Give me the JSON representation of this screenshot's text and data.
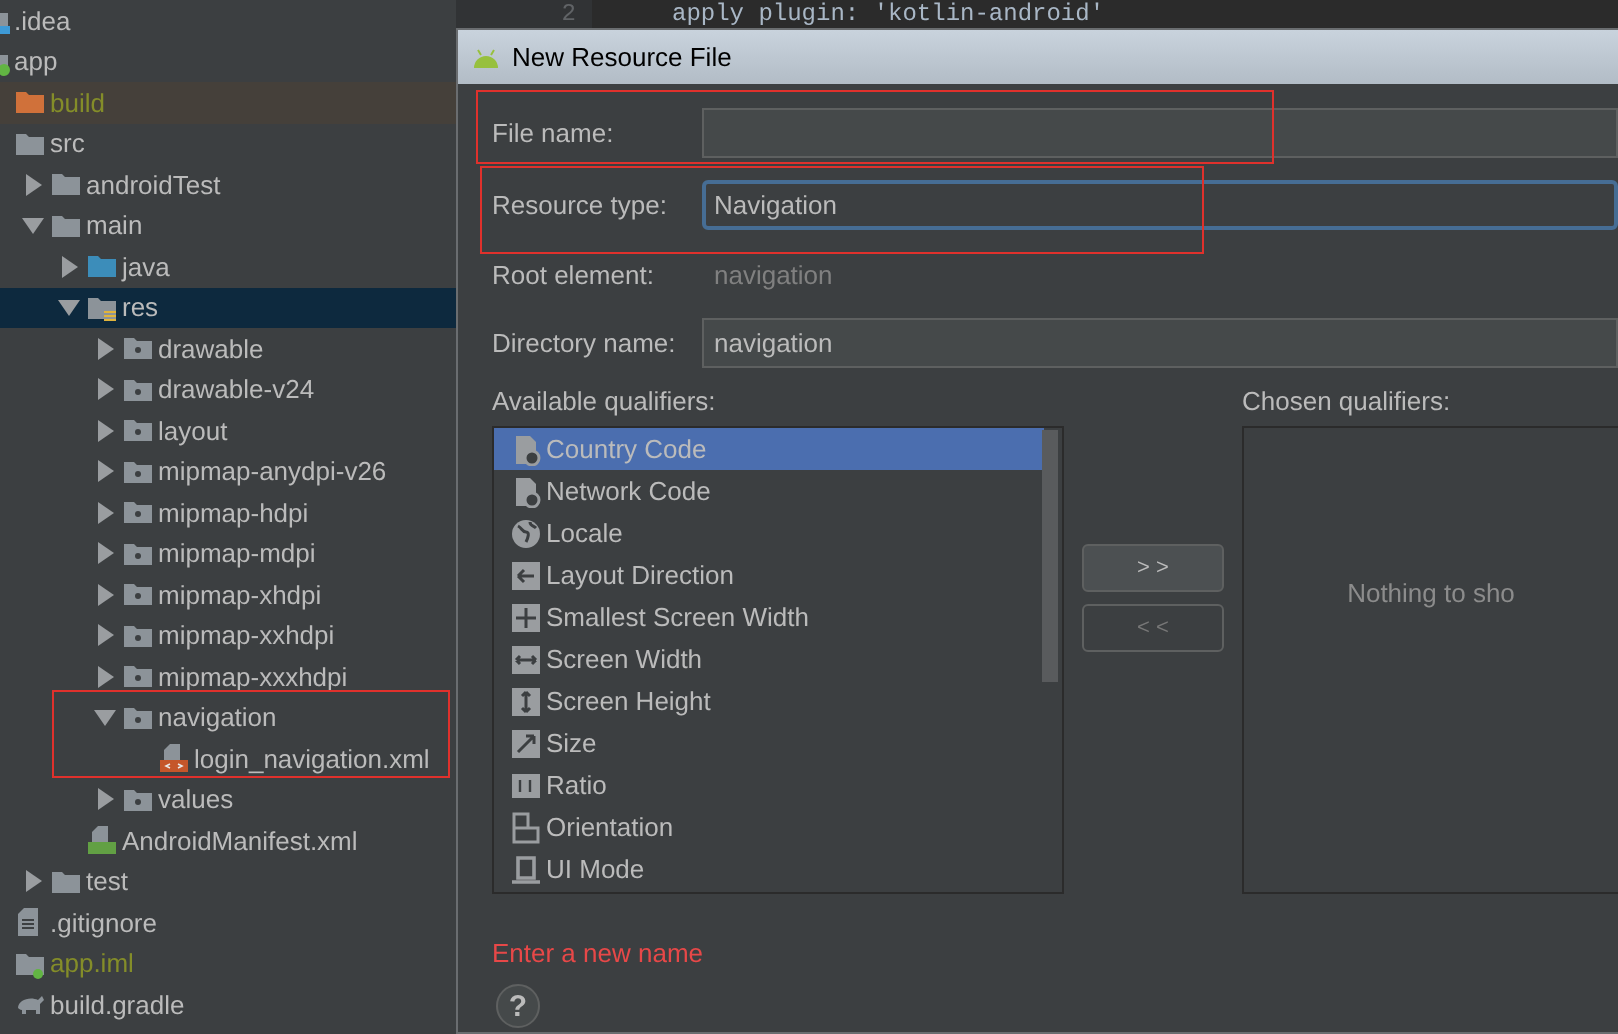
{
  "editor": {
    "line_number": "2",
    "code": "apply plugin: 'kotlin-android'"
  },
  "project_tree": [
    {
      "label": ".idea",
      "kind": "config-folder",
      "selected": false
    },
    {
      "label": "app",
      "kind": "module",
      "selected": false,
      "children": [
        {
          "label": "build",
          "kind": "excluded-folder",
          "excluded": true,
          "selected": false
        },
        {
          "label": "src",
          "kind": "folder",
          "selected": false,
          "children": [
            {
              "label": "androidTest",
              "kind": "folder",
              "expanded": false,
              "selected": false
            },
            {
              "label": "main",
              "kind": "folder",
              "expanded": true,
              "selected": false,
              "children": [
                {
                  "label": "java",
                  "kind": "source-folder",
                  "expanded": false,
                  "selected": false
                },
                {
                  "label": "res",
                  "kind": "res-folder",
                  "expanded": true,
                  "selected": true,
                  "children": [
                    {
                      "label": "drawable",
                      "kind": "res-dir",
                      "expanded": false,
                      "selected": false
                    },
                    {
                      "label": "drawable-v24",
                      "kind": "res-dir",
                      "expanded": false,
                      "selected": false
                    },
                    {
                      "label": "layout",
                      "kind": "res-dir",
                      "expanded": false,
                      "selected": false
                    },
                    {
                      "label": "mipmap-anydpi-v26",
                      "kind": "res-dir",
                      "expanded": false,
                      "selected": false
                    },
                    {
                      "label": "mipmap-hdpi",
                      "kind": "res-dir",
                      "expanded": false,
                      "selected": false
                    },
                    {
                      "label": "mipmap-mdpi",
                      "kind": "res-dir",
                      "expanded": false,
                      "selected": false
                    },
                    {
                      "label": "mipmap-xhdpi",
                      "kind": "res-dir",
                      "expanded": false,
                      "selected": false
                    },
                    {
                      "label": "mipmap-xxhdpi",
                      "kind": "res-dir",
                      "expanded": false,
                      "selected": false
                    },
                    {
                      "label": "mipmap-xxxhdpi",
                      "kind": "res-dir",
                      "expanded": false,
                      "selected": false
                    },
                    {
                      "label": "navigation",
                      "kind": "res-dir",
                      "expanded": true,
                      "selected": false,
                      "highlighted": true,
                      "children": [
                        {
                          "label": "login_navigation.xml",
                          "kind": "xml-file",
                          "selected": false
                        }
                      ]
                    },
                    {
                      "label": "values",
                      "kind": "res-dir",
                      "expanded": false,
                      "selected": false
                    }
                  ]
                },
                {
                  "label": "AndroidManifest.xml",
                  "kind": "manifest-file",
                  "selected": false
                }
              ]
            },
            {
              "label": "test",
              "kind": "folder",
              "expanded": false,
              "selected": false
            }
          ]
        },
        {
          "label": ".gitignore",
          "kind": "text-file",
          "selected": false
        },
        {
          "label": "app.iml",
          "kind": "iml-file",
          "excluded": true,
          "selected": false
        },
        {
          "label": "build.gradle",
          "kind": "gradle-file",
          "selected": false
        }
      ]
    }
  ],
  "dialog": {
    "title": "New Resource File",
    "fields": [
      {
        "label": "File name:",
        "kind": "input",
        "highlighted": true
      },
      {
        "label": "Resource type:",
        "kind": "combo",
        "value": "Navigation",
        "focused": true,
        "highlighted": true
      },
      {
        "label": "Root element:",
        "kind": "static",
        "value": "navigation"
      },
      {
        "label": "Directory name:",
        "kind": "input",
        "value": "navigation"
      }
    ],
    "available_qualifiers": {
      "label": "Available qualifiers:",
      "items": [
        {
          "label": "Country Code",
          "selected": true
        },
        {
          "label": "Network Code",
          "selected": false
        },
        {
          "label": "Locale",
          "selected": false
        },
        {
          "label": "Layout Direction",
          "selected": false
        },
        {
          "label": "Smallest Screen Width",
          "selected": false
        },
        {
          "label": "Screen Width",
          "selected": false
        },
        {
          "label": "Screen Height",
          "selected": false
        },
        {
          "label": "Size",
          "selected": false
        },
        {
          "label": "Ratio",
          "selected": false
        },
        {
          "label": "Orientation",
          "selected": false
        },
        {
          "label": "UI Mode",
          "selected": false
        }
      ]
    },
    "move_buttons": [
      {
        "label": "> >",
        "disabled": false
      },
      {
        "label": "< <",
        "disabled": true
      }
    ],
    "chosen_qualifiers": {
      "label": "Chosen qualifiers:",
      "empty_text": "Nothing to sho"
    },
    "error": "Enter a new name",
    "help_button": "?"
  }
}
